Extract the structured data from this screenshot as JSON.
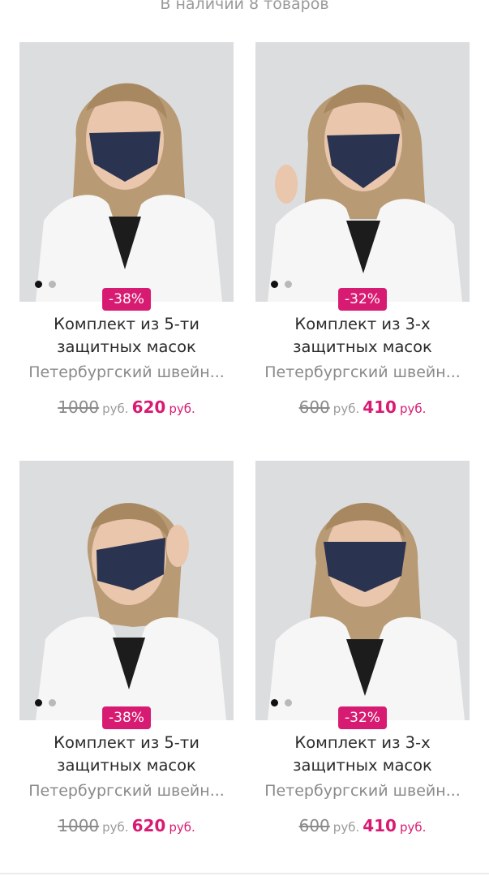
{
  "stock_text": "В наличии 8 товаров",
  "accent_color": "#d81b72",
  "products": [
    {
      "discount": "-38%",
      "title_line1": "Комплект из 5-ти",
      "title_line2": "защитных масок",
      "brand": "Петербургский швейн...",
      "old_price": "1000",
      "old_currency": "руб.",
      "new_price": "620",
      "new_currency": "руб.",
      "image_icon": "woman-mask-photo"
    },
    {
      "discount": "-32%",
      "title_line1": "Комплект из 3-х",
      "title_line2": "защитных масок",
      "brand": "Петербургский швейн...",
      "old_price": "600",
      "old_currency": "руб.",
      "new_price": "410",
      "new_currency": "руб.",
      "image_icon": "woman-mask-photo"
    },
    {
      "discount": "-38%",
      "title_line1": "Комплект из 5-ти",
      "title_line2": "защитных масок",
      "brand": "Петербургский швейн...",
      "old_price": "1000",
      "old_currency": "руб.",
      "new_price": "620",
      "new_currency": "руб.",
      "image_icon": "woman-mask-photo"
    },
    {
      "discount": "-32%",
      "title_line1": "Комплект из 3-х",
      "title_line2": "защитных масок",
      "brand": "Петербургский швейн...",
      "old_price": "600",
      "old_currency": "руб.",
      "new_price": "410",
      "new_currency": "руб.",
      "image_icon": "woman-mask-photo"
    }
  ]
}
